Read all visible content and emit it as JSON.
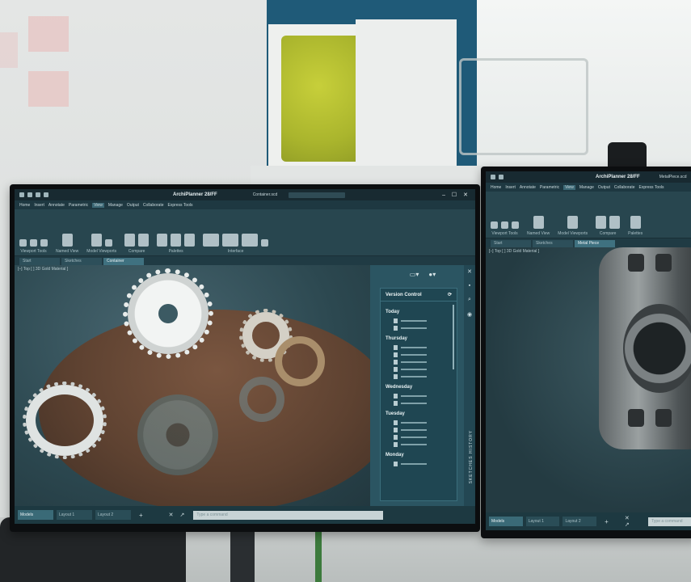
{
  "left_monitor": {
    "app_title": "ArchiPlanner 28/FF",
    "document_name": "Container.scd",
    "window_controls": "– ☐ ✕",
    "menu": [
      "Home",
      "Insert",
      "Annotate",
      "Parametric",
      "View",
      "Manage",
      "Output",
      "Collaborate",
      "Express Tools"
    ],
    "active_menu": "View",
    "ribbon_groups": [
      "Viewport Tools",
      "Named View",
      "Model Viewports",
      "Compare",
      "Palettes",
      "Interface"
    ],
    "tabs": [
      "Start",
      "Sketches",
      "Container"
    ],
    "active_tab": "Container",
    "viewport_label": "[–] Top [ ] 3D Gold Material ]",
    "panel_icons": [
      "monitor-icon",
      "user-icon"
    ],
    "version_control": {
      "title": "Version Control",
      "groups": [
        {
          "day": "Today",
          "items": 2
        },
        {
          "day": "Thursday",
          "items": 5
        },
        {
          "day": "Wednesday",
          "items": 2
        },
        {
          "day": "Tuesday",
          "items": 4
        },
        {
          "day": "Monday",
          "items": 1
        }
      ]
    },
    "side_label": "SKETCHES HISTORY",
    "layout_tabs": [
      "Models",
      "Layout 1",
      "Layout 2"
    ],
    "active_layout": "Models",
    "add_tab": "+",
    "command_controls": "✕ ↗",
    "command_placeholder": "Type a command"
  },
  "right_monitor": {
    "app_title": "ArchiPlanner 28/FF",
    "document_name": "MetalPiece.scd",
    "menu": [
      "Home",
      "Insert",
      "Annotate",
      "Parametric",
      "View",
      "Manage",
      "Output",
      "Collaborate",
      "Express Tools"
    ],
    "active_menu": "View",
    "ribbon_groups": [
      "Viewport Tools",
      "Named View",
      "Model Viewports",
      "Compare",
      "Palettes"
    ],
    "tabs": [
      "Start",
      "Sketches",
      "Metal Piece"
    ],
    "active_tab": "Metal Piece",
    "viewport_label": "[–] Top [ ] 3D Gold Material ]",
    "layout_tabs": [
      "Models",
      "Layout 1",
      "Layout 2"
    ],
    "active_layout": "Models",
    "add_tab": "+",
    "command_controls": "✕ ↗",
    "command_placeholder": "Type a command"
  }
}
